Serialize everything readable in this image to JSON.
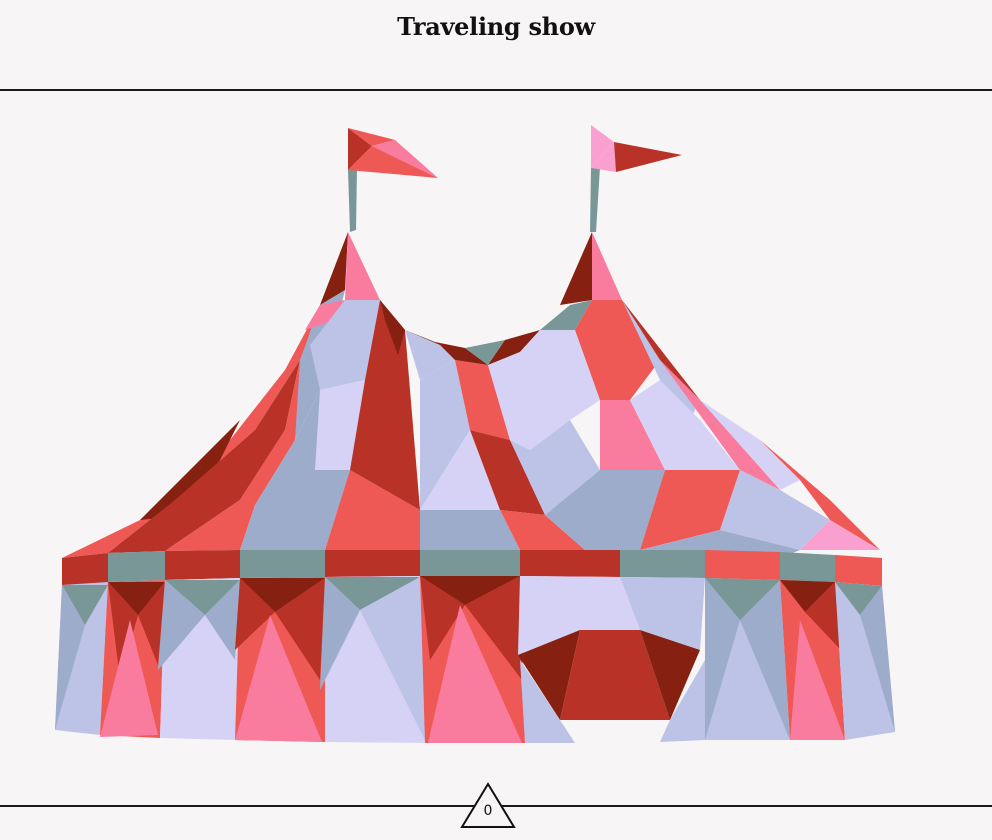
{
  "header": {
    "title": "Traveling show"
  },
  "counter": {
    "value": "0"
  },
  "colors": {
    "background": "#f7f5f5",
    "red": "#b83228",
    "dark_red": "#862010",
    "coral": "#ee5855",
    "pink": "#f97b9e",
    "lavender": "#d6d2f6",
    "periwinkle": "#bcc3e6",
    "steel": "#9eaccc",
    "teal_gray": "#7a9798"
  }
}
